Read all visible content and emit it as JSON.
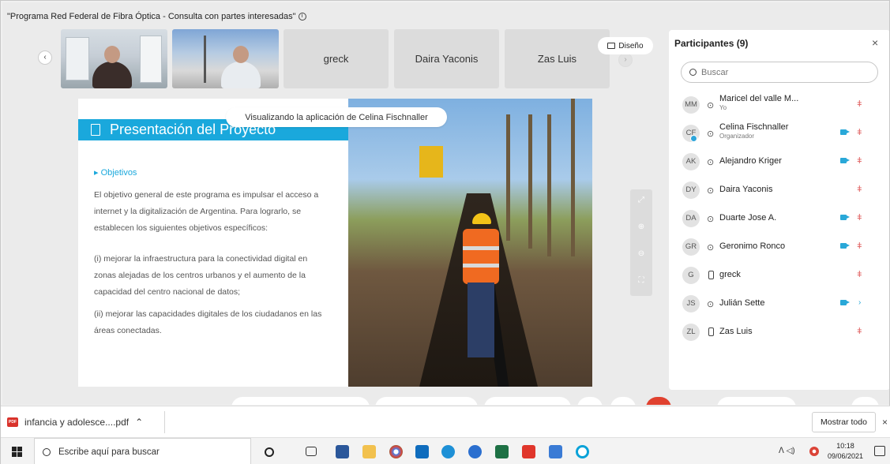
{
  "meeting": {
    "title": "\"Programa Red Federal de Fibra Óptica - Consulta con partes interesadas\"",
    "info_icon": "info-icon",
    "layout_button": "Diseño",
    "tiles": [
      "greck",
      "Daira Yaconis",
      "Zas Luis"
    ],
    "sharing_banner": "Visualizando la aplicación de Celina Fischnaller"
  },
  "slide": {
    "title": "Presentación del Proyecto",
    "subtitle": "▸ Objetivos",
    "paragraph1": "El objetivo general de este programa es impulsar el acceso a internet y la digitalización de Argentina. Para lograrlo, se establecen los siguientes objetivos específicos:",
    "paragraph2": "(i) mejorar la infraestructura para la conectividad digital en zonas alejadas de los centros urbanos y el aumento de la capacidad del centro nacional de datos;",
    "paragraph3": "(ii) mejorar las capacidades digitales de los ciudadanos en las áreas conectadas."
  },
  "participants": {
    "title": "Participantes (9)",
    "close": "×",
    "search_placeholder": "Buscar",
    "list": [
      {
        "initials": "MM",
        "name": "Maricel del valle M...",
        "role": "Yo"
      },
      {
        "initials": "CF",
        "name": "Celina Fischnaller",
        "role": "Organizador"
      },
      {
        "initials": "AK",
        "name": "Alejandro Kriger",
        "role": ""
      },
      {
        "initials": "DY",
        "name": "Daira Yaconis",
        "role": ""
      },
      {
        "initials": "DA",
        "name": "Duarte Jose A.",
        "role": ""
      },
      {
        "initials": "GR",
        "name": "Geronimo Ronco",
        "role": ""
      },
      {
        "initials": "G",
        "name": "greck",
        "role": ""
      },
      {
        "initials": "JS",
        "name": "Julián Sette",
        "role": ""
      },
      {
        "initials": "ZL",
        "name": "Zas Luis",
        "role": ""
      }
    ]
  },
  "downloads": {
    "file_name": "infancia y adolesce....pdf",
    "file_badge": "PDF",
    "show_all": "Mostrar todo",
    "close": "×"
  },
  "taskbar": {
    "search_text": "Escribe aquí para buscar",
    "time": "10:18",
    "date": "09/06/2021",
    "volume": "ᐱ ◁) "
  },
  "colors": {
    "accent": "#1aa8dc",
    "leave": "#e0412f",
    "muted_mic": "#e06060"
  }
}
